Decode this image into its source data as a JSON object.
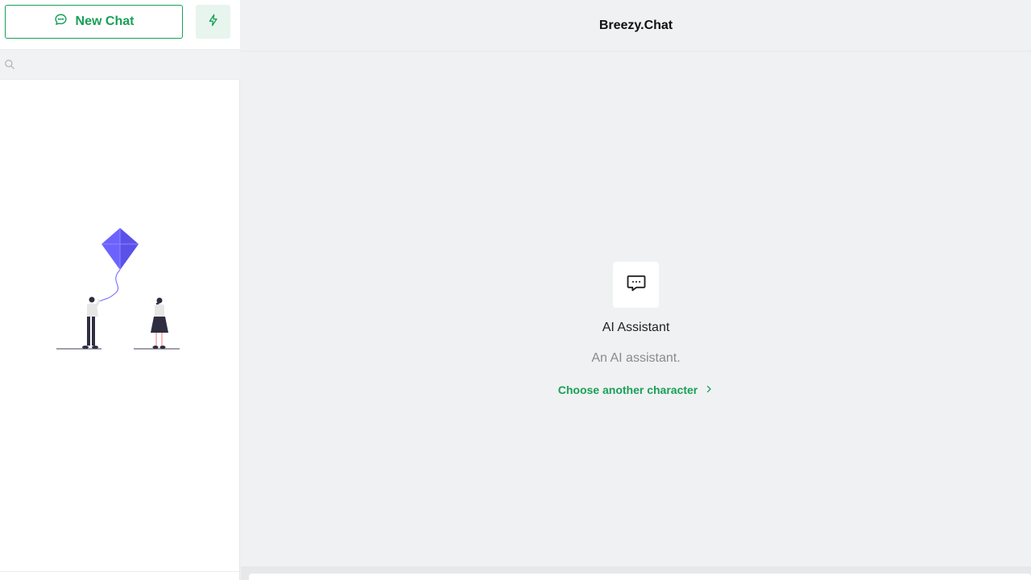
{
  "sidebar": {
    "new_chat_label": "New Chat",
    "new_chat_icon": "chat-bubble-icon",
    "bolt_icon": "lightning-icon",
    "search": {
      "placeholder": "",
      "value": "",
      "icon": "search-icon"
    },
    "illustration": "kite-flying-illustration"
  },
  "header": {
    "title": "Breezy.Chat"
  },
  "main": {
    "character": {
      "icon": "message-dots-icon",
      "name": "AI Assistant",
      "description": "An AI assistant."
    },
    "choose_link_label": "Choose another character",
    "choose_link_icon": "chevron-right-icon"
  },
  "colors": {
    "accent": "#18a058",
    "accent_soft": "#e7f5ee",
    "kite": "#6c63ff",
    "background": "#f0f1f3"
  }
}
